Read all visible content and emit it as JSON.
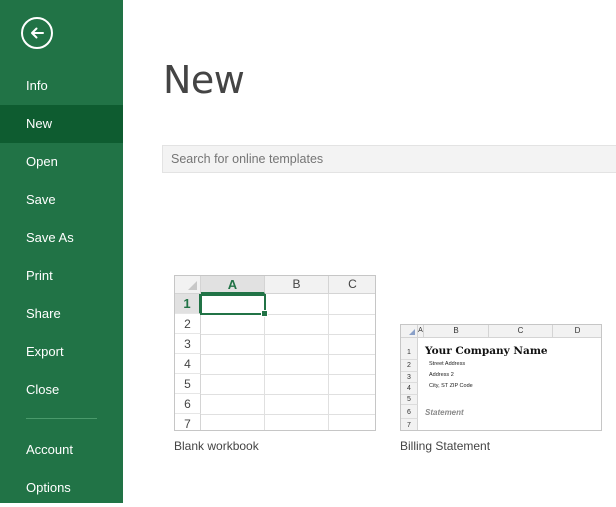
{
  "sidebar": {
    "back_icon": "back-arrow-icon",
    "items": [
      {
        "label": "Info"
      },
      {
        "label": "New"
      },
      {
        "label": "Open"
      },
      {
        "label": "Save"
      },
      {
        "label": "Save As"
      },
      {
        "label": "Print"
      },
      {
        "label": "Share"
      },
      {
        "label": "Export"
      },
      {
        "label": "Close"
      },
      {
        "label": "Account"
      },
      {
        "label": "Options"
      }
    ],
    "active": "New"
  },
  "main": {
    "title": "New",
    "search_placeholder": "Search for online templates",
    "templates": [
      {
        "caption": "Blank workbook",
        "columns": [
          "A",
          "B",
          "C"
        ],
        "rows": [
          "1",
          "2",
          "3",
          "4",
          "5",
          "6",
          "7"
        ]
      },
      {
        "caption": "Billing Statement",
        "columns": [
          "A",
          "B",
          "C",
          "D"
        ],
        "rows": [
          "1",
          "2",
          "3",
          "4",
          "5",
          "6",
          "7"
        ],
        "company": "Your Company Name",
        "address_lines": [
          "Street Address",
          "Address 2",
          "City, ST  ZIP Code"
        ],
        "statement": "Statement"
      }
    ]
  },
  "colors": {
    "brand_green": "#217346",
    "active_green": "#0e5c30"
  }
}
